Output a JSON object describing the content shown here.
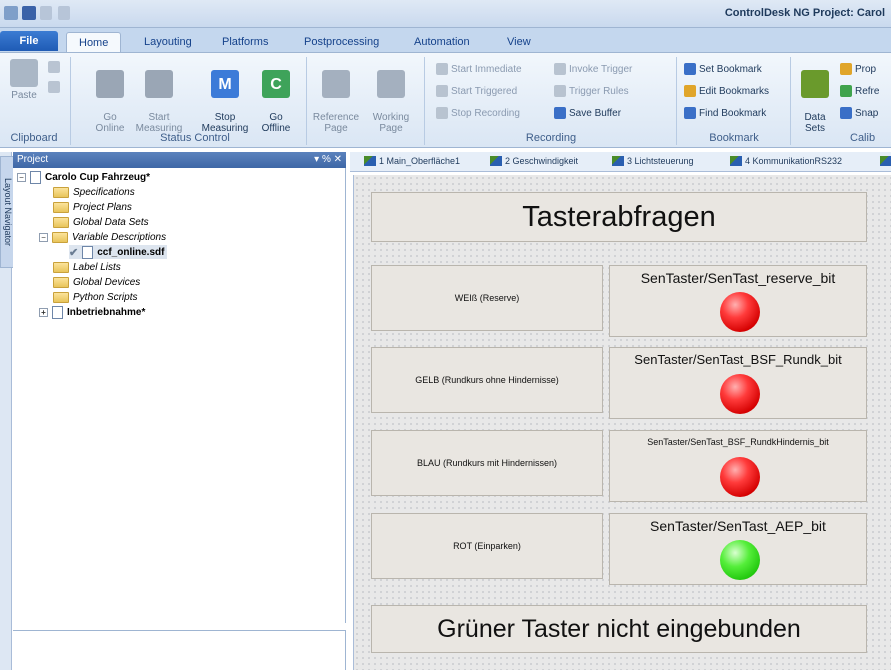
{
  "window": {
    "title": "ControlDesk NG  Project: Carol"
  },
  "ribbon": {
    "tabs": [
      "File",
      "Home",
      "Layouting",
      "Platforms",
      "Postprocessing",
      "Automation",
      "View"
    ],
    "clipboard": {
      "paste": "Paste",
      "label": "Clipboard"
    },
    "status_control": {
      "go_online": "Go\nOnline",
      "start_measuring": "Start\nMeasuring",
      "stop_measuring": "Stop\nMeasuring",
      "go_offline": "Go\nOffline",
      "label": "Status Control"
    },
    "pages": {
      "reference": "Reference\nPage",
      "working": "Working\nPage"
    },
    "recording": {
      "start_immediate": "Start Immediate",
      "invoke_trigger": "Invoke Trigger",
      "start_triggered": "Start Triggered",
      "trigger_rules": "Trigger Rules",
      "stop_recording": "Stop Recording",
      "save_buffer": "Save Buffer",
      "label": "Recording"
    },
    "bookmark": {
      "set": "Set Bookmark",
      "edit": "Edit Bookmarks",
      "find": "Find Bookmark",
      "label": "Bookmark"
    },
    "calibration": {
      "data_sets": "Data\nSets",
      "prop": "Prop",
      "refre": "Refre",
      "snap": "Snap",
      "label": "Calib"
    }
  },
  "side_strip": {
    "label": "Layout Navigator"
  },
  "project": {
    "header": "Project",
    "header_controls": "▾ % ✕",
    "root": "Carolo Cup Fahrzeug*",
    "items": [
      "Specifications",
      "Project Plans",
      "Global Data Sets",
      "Variable Descriptions",
      "ccf_online.sdf",
      "Label Lists",
      "Global Devices",
      "Python Scripts",
      "Inbetriebnahme*"
    ]
  },
  "layout_tabs": [
    "1 Main_Oberfläche1",
    "2 Geschwindigkeit",
    "3 Lichtsteuerung",
    "4 KommunikationRS232"
  ],
  "canvas": {
    "heading": "Tasterabfragen",
    "footer": "Grüner Taster nicht eingebunden",
    "rows": [
      {
        "label": "WEIß (Reserve)",
        "signal": "SenTaster/SenTast_reserve_bit",
        "state": "red"
      },
      {
        "label": "GELB (Rundkurs ohne Hindernisse)",
        "signal": "SenTaster/SenTast_BSF_Rundk_bit",
        "state": "red"
      },
      {
        "label": "BLAU (Rundkurs mit Hindernissen)",
        "signal": "SenTaster/SenTast_BSF_RundkHindernis_bit",
        "state": "red"
      },
      {
        "label": "ROT (Einparken)",
        "signal": "SenTaster/SenTast_AEP_bit",
        "state": "green"
      }
    ]
  },
  "colors": {
    "lamp_off": "#e01010",
    "lamp_on": "#33dd22",
    "ribbon_accent": "#1f5bb5"
  }
}
